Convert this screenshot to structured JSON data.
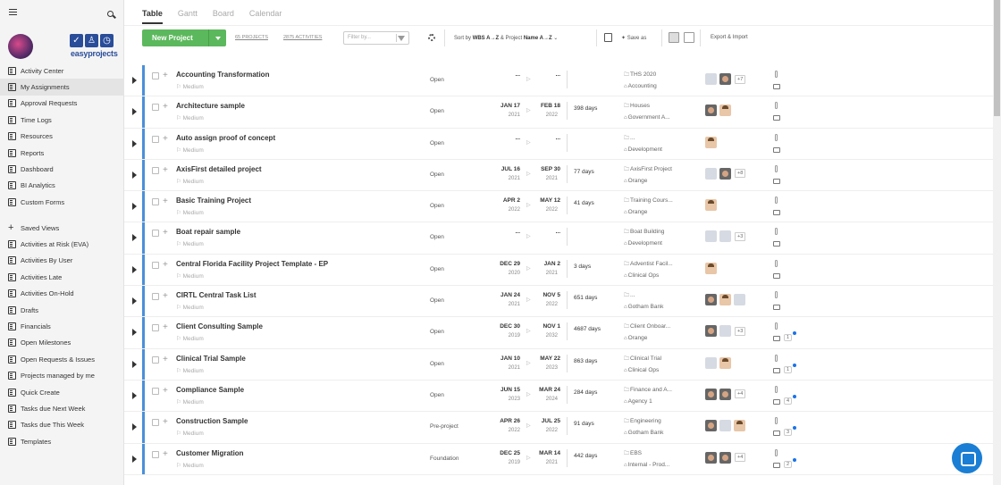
{
  "sidebar": {
    "logo_text": "easyprojects",
    "items_main": [
      {
        "label": "Activity Center",
        "icon": "home-icon"
      },
      {
        "label": "My Assignments",
        "icon": "checkbox-icon",
        "active": true
      },
      {
        "label": "Approval Requests",
        "icon": "list-icon"
      },
      {
        "label": "Time Logs",
        "icon": "stopwatch-icon"
      },
      {
        "label": "Resources",
        "icon": "person-icon"
      },
      {
        "label": "Reports",
        "icon": "bar-chart-icon"
      },
      {
        "label": "Dashboard",
        "icon": "gauge-icon"
      },
      {
        "label": "BI Analytics",
        "icon": "analytics-icon"
      },
      {
        "label": "Custom Forms",
        "icon": "form-icon"
      }
    ],
    "saved_views_label": "Saved Views",
    "items_views": [
      "Activities at Risk (EVA)",
      "Activities By User",
      "Activities Late",
      "Activities On-Hold",
      "Drafts",
      "Financials",
      "Open Milestones",
      "Open Requests & Issues",
      "Projects managed by me",
      "Quick Create",
      "Tasks due Next Week",
      "Tasks due This Week",
      "Templates"
    ]
  },
  "tabs": [
    "Table",
    "Gantt",
    "Board",
    "Calendar"
  ],
  "toolbar": {
    "new_project": "New Project",
    "projects_count": "65 PROJECTS",
    "activities_count": "2875 ACTIVITIES",
    "filter_placeholder": "Filter by...",
    "sort_prefix": "Sort by",
    "sort_key1": "WBS A→Z",
    "sort_mid": "& Project",
    "sort_key2": "Name A→Z",
    "save_as": "Save as",
    "export_import": "Export & Import"
  },
  "rows": [
    {
      "name": "Accounting Transformation",
      "priority": "Medium",
      "status": "Open",
      "start": "...",
      "start_year": "",
      "end": "...",
      "end_year": "",
      "days": "",
      "portfolio": "THS 2020",
      "client": "Accounting",
      "avatars": [
        "g",
        "d"
      ],
      "more": "+7",
      "comments": ""
    },
    {
      "name": "Architecture sample",
      "priority": "Medium",
      "status": "Open",
      "start": "JAN 17",
      "start_year": "2021",
      "end": "FEB 18",
      "end_year": "2022",
      "days": "398 days",
      "portfolio": "Houses",
      "client": "Government A...",
      "avatars": [
        "d",
        "p"
      ],
      "more": "",
      "comments": ""
    },
    {
      "name": "Auto assign proof of concept",
      "priority": "Medium",
      "status": "Open",
      "start": "...",
      "start_year": "",
      "end": "...",
      "end_year": "",
      "days": "",
      "portfolio": "...",
      "client": "Development",
      "avatars": [
        "p"
      ],
      "more": "",
      "comments": ""
    },
    {
      "name": "AxisFirst detailed project",
      "priority": "Medium",
      "status": "Open",
      "start": "JUL 16",
      "start_year": "2021",
      "end": "SEP 30",
      "end_year": "2021",
      "days": "77 days",
      "portfolio": "AxisFirst Project",
      "client": "Orange",
      "avatars": [
        "g",
        "d"
      ],
      "more": "+8",
      "comments": ""
    },
    {
      "name": "Basic Training Project",
      "priority": "Medium",
      "status": "Open",
      "start": "APR 2",
      "start_year": "2022",
      "end": "MAY 12",
      "end_year": "2022",
      "days": "41 days",
      "portfolio": "Training Cours...",
      "client": "Orange",
      "avatars": [
        "p"
      ],
      "more": "",
      "comments": ""
    },
    {
      "name": "Boat repair sample",
      "priority": "Medium",
      "status": "Open",
      "start": "...",
      "start_year": "",
      "end": "...",
      "end_year": "",
      "days": "",
      "portfolio": "Boat Building",
      "client": "Development",
      "avatars": [
        "g",
        "g"
      ],
      "more": "+3",
      "comments": ""
    },
    {
      "name": "Central Florida Facility Project Template - EP",
      "priority": "Medium",
      "status": "Open",
      "start": "DEC 29",
      "start_year": "2020",
      "end": "JAN 2",
      "end_year": "2021",
      "days": "3 days",
      "portfolio": "Adventist Facil...",
      "client": "Clinical Ops",
      "avatars": [
        "p"
      ],
      "more": "",
      "comments": ""
    },
    {
      "name": "CIRTL Central Task List",
      "priority": "Medium",
      "status": "Open",
      "start": "JAN 24",
      "start_year": "2021",
      "end": "NOV 5",
      "end_year": "2022",
      "days": "651 days",
      "portfolio": "...",
      "client": "Gotham Bank",
      "avatars": [
        "d",
        "p",
        "g"
      ],
      "more": "",
      "comments": ""
    },
    {
      "name": "Client Consulting Sample",
      "priority": "Medium",
      "status": "Open",
      "start": "DEC 30",
      "start_year": "2019",
      "end": "NOV 1",
      "end_year": "2032",
      "days": "4687 days",
      "portfolio": "Client Onboar...",
      "client": "Orange",
      "avatars": [
        "d",
        "g"
      ],
      "more": "+3",
      "comments": "1"
    },
    {
      "name": "Clinical Trial Sample",
      "priority": "Medium",
      "status": "Open",
      "start": "JAN 10",
      "start_year": "2021",
      "end": "MAY 22",
      "end_year": "2023",
      "days": "863 days",
      "portfolio": "Clinical Trial",
      "client": "Clinical Ops",
      "avatars": [
        "g",
        "p"
      ],
      "more": "",
      "comments": "1"
    },
    {
      "name": "Compliance Sample",
      "priority": "Medium",
      "status": "Open",
      "start": "JUN 15",
      "start_year": "2023",
      "end": "MAR 24",
      "end_year": "2024",
      "days": "284 days",
      "portfolio": "Finance and A...",
      "client": "Agency 1",
      "avatars": [
        "d",
        "d"
      ],
      "more": "+4",
      "comments": "4"
    },
    {
      "name": "Construction Sample",
      "priority": "Medium",
      "status": "Pre-project",
      "start": "APR 26",
      "start_year": "2022",
      "end": "JUL 25",
      "end_year": "2022",
      "days": "91 days",
      "portfolio": "Engineering",
      "client": "Gotham Bank",
      "avatars": [
        "d",
        "g",
        "p"
      ],
      "more": "",
      "comments": "3"
    },
    {
      "name": "Customer Migration",
      "priority": "Medium",
      "status": "Foundation",
      "start": "DEC 25",
      "start_year": "2019",
      "end": "MAR 14",
      "end_year": "2021",
      "days": "442 days",
      "portfolio": "EBS",
      "client": "Internal - Prod...",
      "avatars": [
        "d",
        "d"
      ],
      "more": "+4",
      "comments": "2"
    }
  ]
}
